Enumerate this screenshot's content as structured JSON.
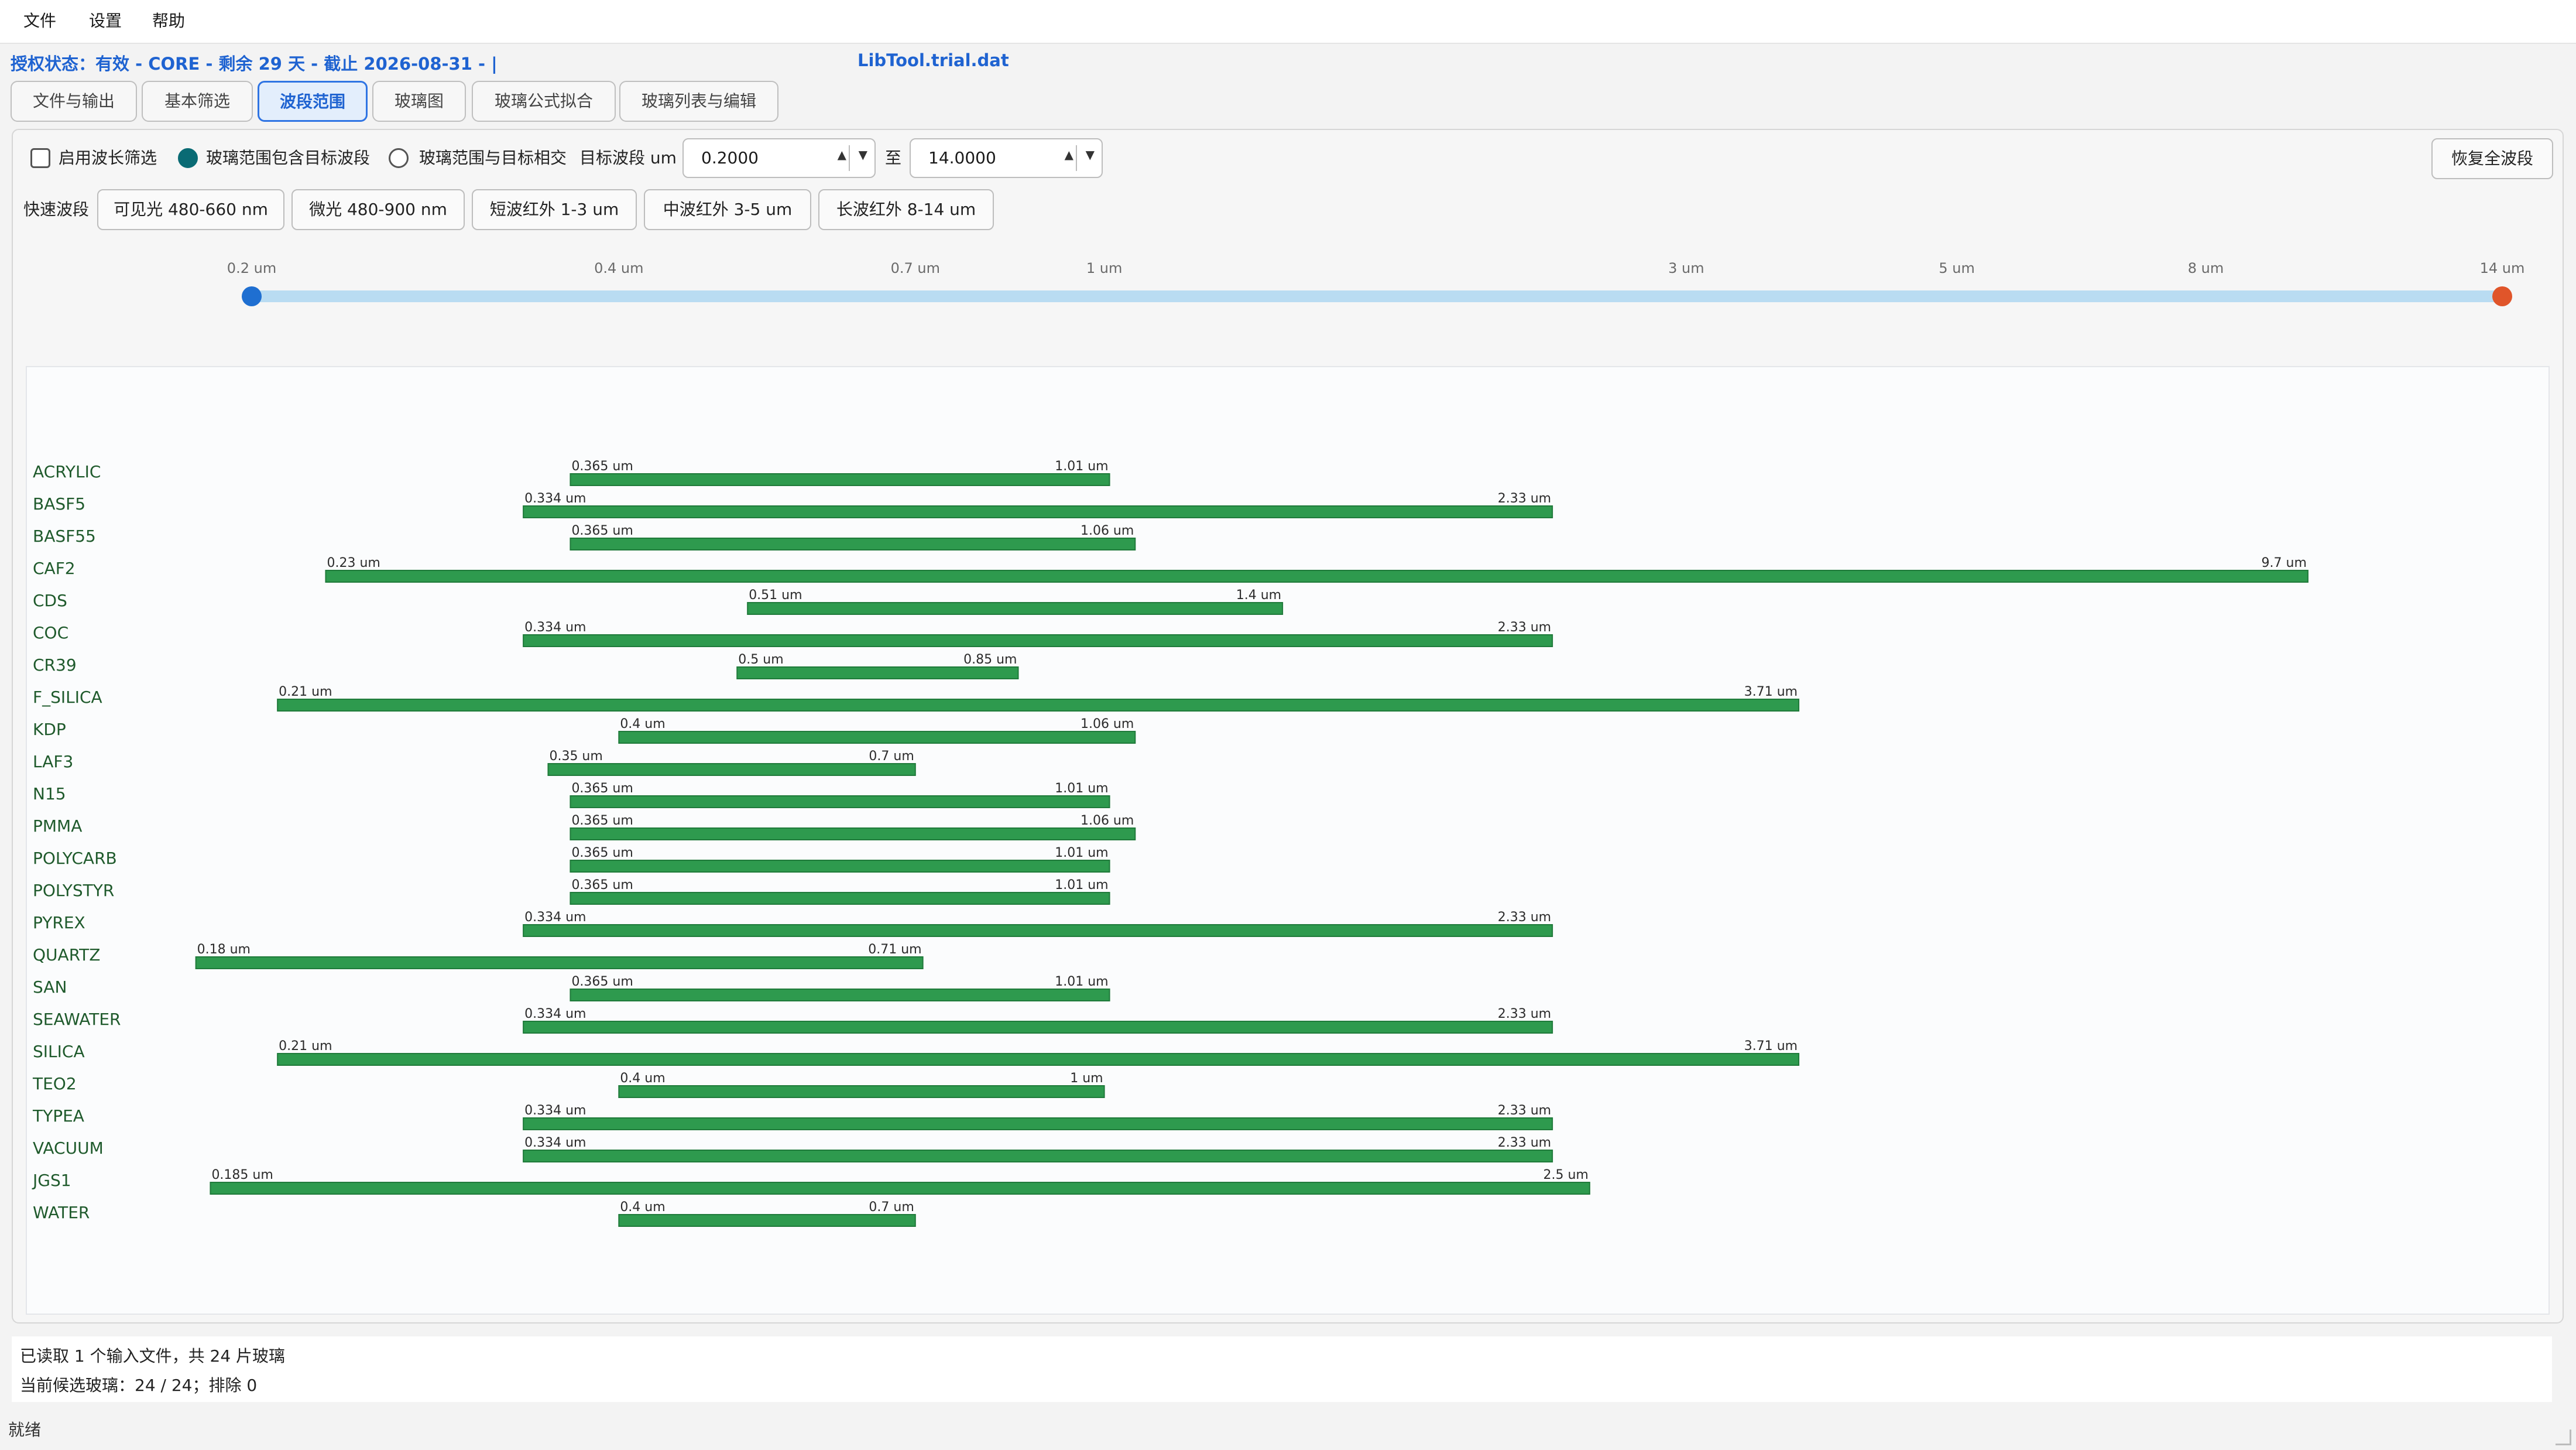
{
  "menu": [
    "文件",
    "设置",
    "帮助"
  ],
  "status_line": "授权状态：有效 - CORE - 剩余 29 天 - 截止 2026-08-31 - |",
  "file_title": "LibTool.trial.dat",
  "tabs": [
    {
      "label": "文件与输出",
      "active": false
    },
    {
      "label": "基本筛选",
      "active": false
    },
    {
      "label": "波段范围",
      "active": true
    },
    {
      "label": "玻璃图",
      "active": false
    },
    {
      "label": "玻璃公式拟合",
      "active": false
    },
    {
      "label": "玻璃列表与编辑",
      "active": false
    }
  ],
  "controls": {
    "enable_filter_label": "启用波长筛选",
    "enable_filter_checked": false,
    "mode_contains_label": "玻璃范围包含目标波段",
    "mode_contains_selected": true,
    "mode_intersect_label": "玻璃范围与目标相交",
    "target_label": "目标波段 um",
    "min_value": "0.2000",
    "to_label": "至",
    "max_value": "14.0000",
    "reset_button": "恢复全波段",
    "quick_label": "快速波段",
    "quick_bands": [
      "可见光 480-660 nm",
      "微光 480-900 nm",
      "短波红外 1-3 um",
      "中波红外 3-5 um",
      "长波红外 8-14 um"
    ]
  },
  "slider": {
    "min": 0.2,
    "max": 14,
    "low_value": 0.2,
    "high_value": 14,
    "scale": "log",
    "ticks": [
      {
        "value": 0.2,
        "label": "0.2 um"
      },
      {
        "value": 0.4,
        "label": "0.4 um"
      },
      {
        "value": 0.7,
        "label": "0.7 um"
      },
      {
        "value": 1,
        "label": "1 um"
      },
      {
        "value": 3,
        "label": "3 um"
      },
      {
        "value": 5,
        "label": "5 um"
      },
      {
        "value": 8,
        "label": "8 um"
      },
      {
        "value": 14,
        "label": "14 um"
      }
    ],
    "track_color": "#b9dcf2",
    "low_handle_color": "#1f6fd1",
    "high_handle_color": "#e0552a"
  },
  "chart_data": {
    "type": "bar",
    "orientation": "horizontal-range",
    "x_unit": "um",
    "x_scale": "log",
    "xlim": [
      0.2,
      14
    ],
    "bar_color": "#2e9a4e",
    "label_color": "#1f5a2c",
    "series": [
      {
        "name": "ACRYLIC",
        "min": 0.365,
        "max": 1.01,
        "min_label": "0.365 um",
        "max_label": "1.01 um"
      },
      {
        "name": "BASF5",
        "min": 0.334,
        "max": 2.33,
        "min_label": "0.334 um",
        "max_label": "2.33 um"
      },
      {
        "name": "BASF55",
        "min": 0.365,
        "max": 1.06,
        "min_label": "0.365 um",
        "max_label": "1.06 um"
      },
      {
        "name": "CAF2",
        "min": 0.23,
        "max": 9.7,
        "min_label": "0.23 um",
        "max_label": "9.7 um"
      },
      {
        "name": "CDS",
        "min": 0.51,
        "max": 1.4,
        "min_label": "0.51 um",
        "max_label": "1.4 um"
      },
      {
        "name": "COC",
        "min": 0.334,
        "max": 2.33,
        "min_label": "0.334 um",
        "max_label": "2.33 um"
      },
      {
        "name": "CR39",
        "min": 0.5,
        "max": 0.85,
        "min_label": "0.5 um",
        "max_label": "0.85 um"
      },
      {
        "name": "F_SILICA",
        "min": 0.21,
        "max": 3.71,
        "min_label": "0.21 um",
        "max_label": "3.71 um"
      },
      {
        "name": "KDP",
        "min": 0.4,
        "max": 1.06,
        "min_label": "0.4 um",
        "max_label": "1.06 um"
      },
      {
        "name": "LAF3",
        "min": 0.35,
        "max": 0.7,
        "min_label": "0.35 um",
        "max_label": "0.7 um"
      },
      {
        "name": "N15",
        "min": 0.365,
        "max": 1.01,
        "min_label": "0.365 um",
        "max_label": "1.01 um"
      },
      {
        "name": "PMMA",
        "min": 0.365,
        "max": 1.06,
        "min_label": "0.365 um",
        "max_label": "1.06 um"
      },
      {
        "name": "POLYCARB",
        "min": 0.365,
        "max": 1.01,
        "min_label": "0.365 um",
        "max_label": "1.01 um"
      },
      {
        "name": "POLYSTYR",
        "min": 0.365,
        "max": 1.01,
        "min_label": "0.365 um",
        "max_label": "1.01 um"
      },
      {
        "name": "PYREX",
        "min": 0.334,
        "max": 2.33,
        "min_label": "0.334 um",
        "max_label": "2.33 um"
      },
      {
        "name": "QUARTZ",
        "min": 0.18,
        "max": 0.71,
        "min_label": "0.18 um",
        "max_label": "0.71 um"
      },
      {
        "name": "SAN",
        "min": 0.365,
        "max": 1.01,
        "min_label": "0.365 um",
        "max_label": "1.01 um"
      },
      {
        "name": "SEAWATER",
        "min": 0.334,
        "max": 2.33,
        "min_label": "0.334 um",
        "max_label": "2.33 um"
      },
      {
        "name": "SILICA",
        "min": 0.21,
        "max": 3.71,
        "min_label": "0.21 um",
        "max_label": "3.71 um"
      },
      {
        "name": "TEO2",
        "min": 0.4,
        "max": 1,
        "min_label": "0.4 um",
        "max_label": "1 um"
      },
      {
        "name": "TYPEA",
        "min": 0.334,
        "max": 2.33,
        "min_label": "0.334 um",
        "max_label": "2.33 um"
      },
      {
        "name": "VACUUM",
        "min": 0.334,
        "max": 2.33,
        "min_label": "0.334 um",
        "max_label": "2.33 um"
      },
      {
        "name": "JGS1",
        "min": 0.185,
        "max": 2.5,
        "min_label": "0.185 um",
        "max_label": "2.5 um"
      },
      {
        "name": "WATER",
        "min": 0.4,
        "max": 0.7,
        "min_label": "0.4 um",
        "max_label": "0.7 um"
      }
    ]
  },
  "info": {
    "line1": "已读取 1 个输入文件，共 24 片玻璃",
    "line2": "当前候选玻璃：24 / 24；排除 0"
  },
  "statusbar": "就绪"
}
